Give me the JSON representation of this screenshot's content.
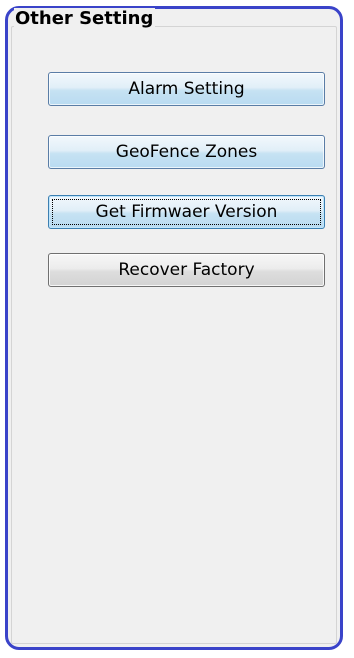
{
  "group": {
    "title": "Other Setting"
  },
  "buttons": {
    "alarm_setting": "Alarm Setting",
    "geofence_zones": "GeoFence Zones",
    "get_firmware_version": "Get Firmwaer Version",
    "recover_factory": "Recover Factory"
  },
  "colors": {
    "border_accent": "#3a43c9",
    "panel_background": "#f0f0f0"
  }
}
